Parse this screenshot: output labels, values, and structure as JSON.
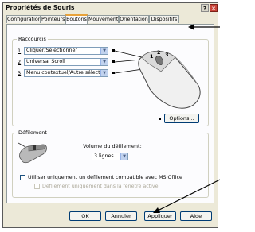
{
  "window": {
    "title": "Propriétés de Souris",
    "help_label": "?",
    "close_label": "✕"
  },
  "tabs": [
    {
      "label": "Configuration"
    },
    {
      "label": "Pointeurs"
    },
    {
      "label": "Boutons"
    },
    {
      "label": "Mouvement"
    },
    {
      "label": "Orientation"
    },
    {
      "label": "Dispositifs"
    }
  ],
  "shortcuts": {
    "title": "Raccourcis",
    "rows": [
      {
        "num": "1",
        "value": "Cliquer/Sélectionner"
      },
      {
        "num": "2",
        "value": "Universal Scroll"
      },
      {
        "num": "3",
        "value": "Menu contextuel/Autre sélection"
      }
    ],
    "mouse_numbers": [
      "1",
      "2",
      "3"
    ],
    "options_label": "Options..."
  },
  "scrolling": {
    "title": "Défilement",
    "volume_label": "Volume du défilement:",
    "volume_value": "3 lignes",
    "checkbox1": "Utiliser uniquement un défilement compatible avec MS Office",
    "checkbox2": "Défilement uniquement dans la fenêtre active"
  },
  "buttons": {
    "ok": "OK",
    "cancel": "Annuler",
    "apply": "Appliquer",
    "help": "Aide"
  },
  "colors": {
    "active_tab_accent": "#e8a23a",
    "close_button": "#c9453a"
  }
}
